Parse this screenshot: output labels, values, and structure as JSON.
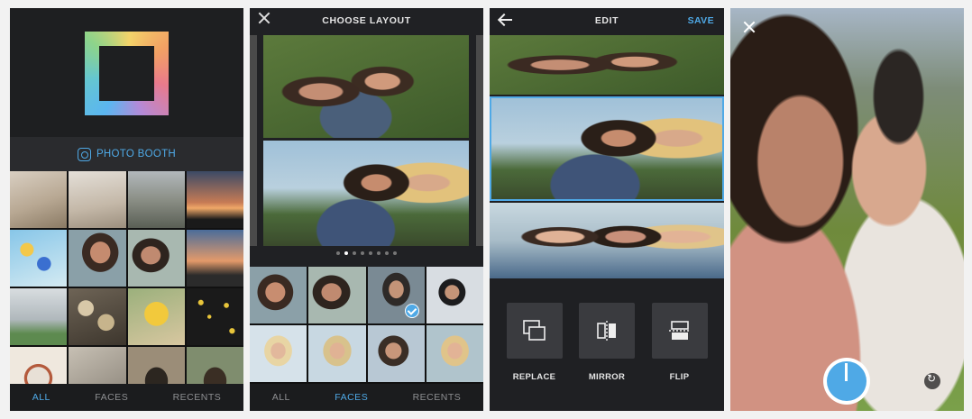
{
  "panels": {
    "picker": {
      "booth_label": "PHOTO BOOTH",
      "tabs": [
        {
          "label": "ALL",
          "active": true
        },
        {
          "label": "FACES",
          "active": false
        },
        {
          "label": "RECENTS",
          "active": false
        }
      ]
    },
    "layout": {
      "title": "CHOOSE LAYOUT",
      "page_dots": 8,
      "active_dot": 1,
      "tabs": [
        {
          "label": "ALL",
          "active": false
        },
        {
          "label": "FACES",
          "active": true
        },
        {
          "label": "RECENTS",
          "active": false
        }
      ]
    },
    "edit": {
      "title": "EDIT",
      "save_label": "SAVE",
      "tools": [
        {
          "label": "REPLACE",
          "icon": "replace-icon"
        },
        {
          "label": "MIRROR",
          "icon": "mirror-icon"
        },
        {
          "label": "FLIP",
          "icon": "flip-icon"
        }
      ]
    },
    "camera": {}
  },
  "colors": {
    "accent": "#4fa9e6",
    "panel_bg": "#1e1f21",
    "inactive_tab": "#8e8f92"
  }
}
